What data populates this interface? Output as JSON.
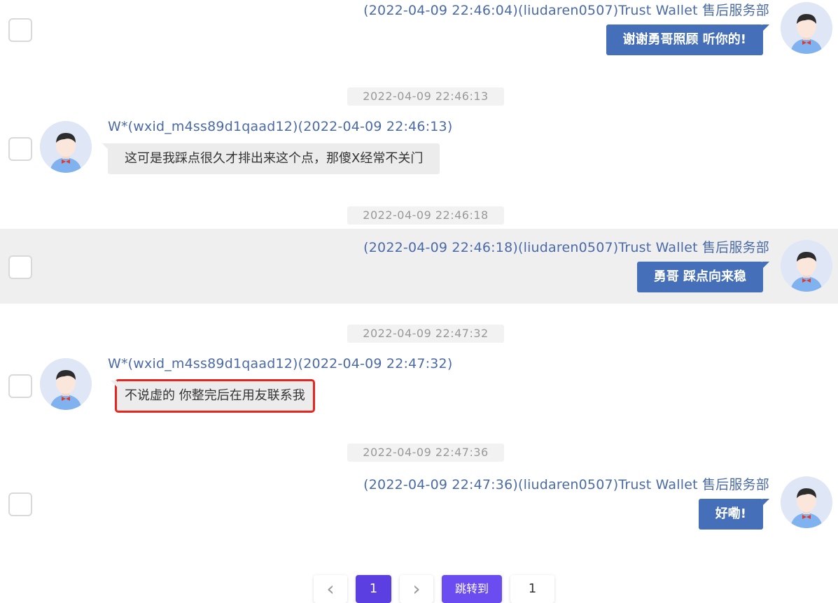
{
  "messages": [
    {
      "direction": "out",
      "meta": "(2022-04-09 22:46:04)(liudaren0507)Trust Wallet 售后服务部",
      "text": "谢谢勇哥照顾 听你的!"
    },
    {
      "separator": "2022-04-09 22:46:13",
      "direction": "in",
      "meta": "W*(wxid_m4ss89d1qaad12)(2022-04-09 22:46:13)",
      "text": "这可是我踩点很久才排出来这个点，那傻X经常不关门"
    },
    {
      "separator": "2022-04-09 22:46:18",
      "direction": "out",
      "meta": "(2022-04-09 22:46:18)(liudaren0507)Trust Wallet 售后服务部",
      "text": "勇哥 踩点向来稳"
    },
    {
      "separator": "2022-04-09 22:47:32",
      "direction": "in",
      "meta": "W*(wxid_m4ss89d1qaad12)(2022-04-09 22:47:32)",
      "text": "不说虚的 你整完后在用友联系我"
    },
    {
      "separator": "2022-04-09 22:47:36",
      "direction": "out",
      "meta": "(2022-04-09 22:47:36)(liudaren0507)Trust Wallet 售后服务部",
      "text": "好嘞!"
    }
  ],
  "pagination": {
    "prev": "‹",
    "current": "1",
    "next": "›",
    "jump_label": "跳转到",
    "jump_value": "1"
  },
  "colors": {
    "outgoing_bubble": "#456fb9",
    "incoming_bubble": "#ececec",
    "meta_text": "#4a6aa8",
    "highlight_box": "#e8241f",
    "pager_active": "#5b3fe0"
  }
}
